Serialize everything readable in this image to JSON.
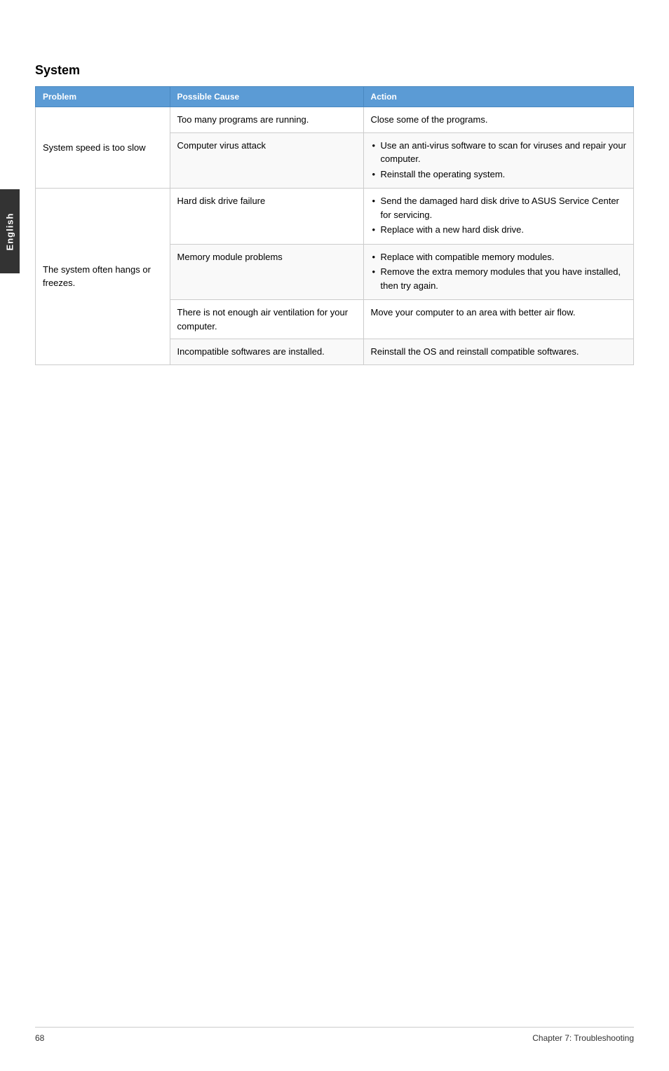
{
  "sidebar": {
    "label": "English"
  },
  "section": {
    "title": "System"
  },
  "table": {
    "headers": {
      "problem": "Problem",
      "cause": "Possible Cause",
      "action": "Action"
    },
    "rows": [
      {
        "problem": "System speed is too slow",
        "cause": "Too many programs are running.",
        "action_type": "text",
        "action": "Close some of the programs."
      },
      {
        "problem": "",
        "cause": "Computer virus attack",
        "action_type": "bullets",
        "action_bullets": [
          "Use an anti-virus software to scan for viruses and repair your computer.",
          "Reinstall the operating system."
        ]
      },
      {
        "problem": "The system often hangs or freezes.",
        "cause": "Hard disk drive failure",
        "action_type": "bullets",
        "action_bullets": [
          "Send the damaged hard disk drive to ASUS Service Center for servicing.",
          "Replace with a new hard disk drive."
        ]
      },
      {
        "problem": "",
        "cause": "Memory module problems",
        "action_type": "bullets",
        "action_bullets": [
          "Replace with compatible memory modules.",
          "Remove the extra memory modules that you have installed, then try again."
        ]
      },
      {
        "problem": "",
        "cause": "There is not enough air ventilation for your computer.",
        "action_type": "text",
        "action": "Move your computer to an area with better air flow."
      },
      {
        "problem": "",
        "cause": "Incompatible softwares are installed.",
        "action_type": "text",
        "action": "Reinstall the OS and reinstall compatible softwares."
      }
    ]
  },
  "footer": {
    "page_number": "68",
    "chapter": "Chapter 7: Troubleshooting"
  }
}
